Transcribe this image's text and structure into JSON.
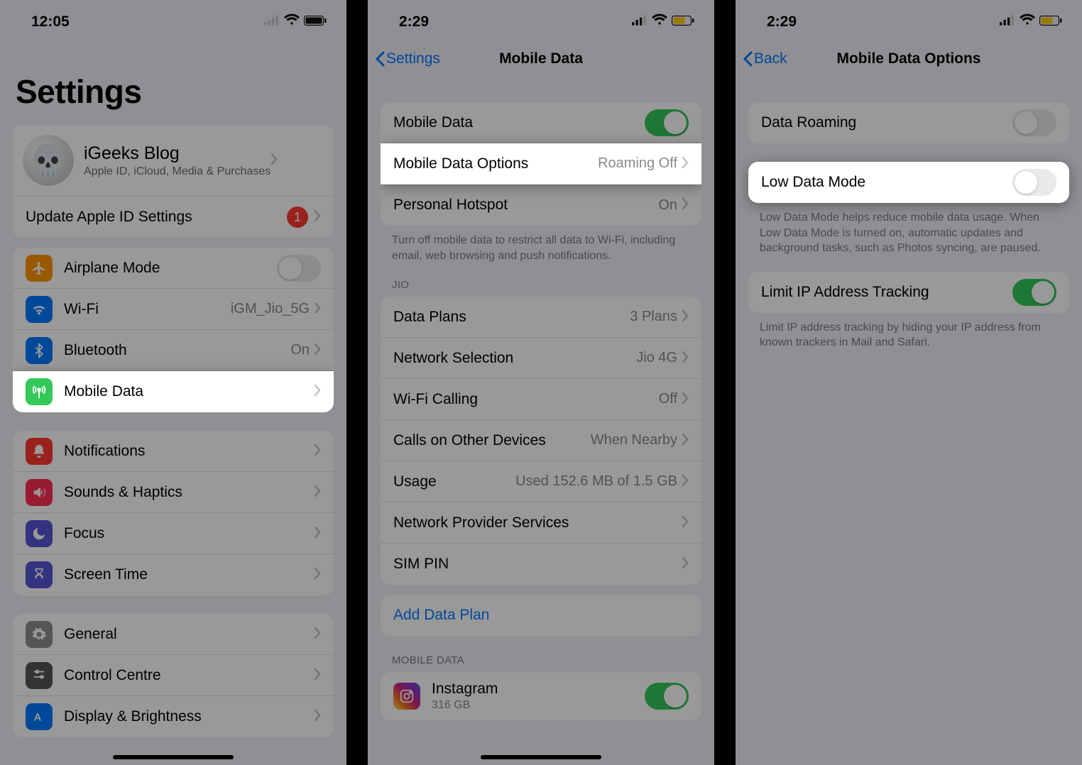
{
  "screen1": {
    "time": "12:05",
    "title": "Settings",
    "profile": {
      "name": "iGeeks Blog",
      "sub": "Apple ID, iCloud, Media & Purchases"
    },
    "update_apple_id": {
      "label": "Update Apple ID Settings",
      "badge": "1"
    },
    "rows": {
      "airplane": "Airplane Mode",
      "wifi": {
        "label": "Wi-Fi",
        "value": "iGM_Jio_5G"
      },
      "bluetooth": {
        "label": "Bluetooth",
        "value": "On"
      },
      "mobile_data": "Mobile Data",
      "notifications": "Notifications",
      "sounds": "Sounds & Haptics",
      "focus": "Focus",
      "screen_time": "Screen Time",
      "general": "General",
      "control_centre": "Control Centre",
      "display": "Display & Brightness"
    }
  },
  "screen2": {
    "time": "2:29",
    "back": "Settings",
    "title": "Mobile Data",
    "rows": {
      "mobile_data": "Mobile Data",
      "options": {
        "label": "Mobile Data Options",
        "value": "Roaming Off"
      },
      "hotspot": {
        "label": "Personal Hotspot",
        "value": "On"
      }
    },
    "note1": "Turn off mobile data to restrict all data to Wi-Fi, including email, web browsing and push notifications.",
    "header_jio": "JIO",
    "jio": {
      "data_plans": {
        "label": "Data Plans",
        "value": "3 Plans"
      },
      "network_selection": {
        "label": "Network Selection",
        "value": "Jio 4G"
      },
      "wifi_calling": {
        "label": "Wi-Fi Calling",
        "value": "Off"
      },
      "calls_other": {
        "label": "Calls on Other Devices",
        "value": "When Nearby"
      },
      "usage": {
        "label": "Usage",
        "value": "Used 152.6 MB of 1.5 GB"
      },
      "provider": "Network Provider Services",
      "sim_pin": "SIM PIN"
    },
    "add_plan": "Add Data Plan",
    "header_md": "MOBILE DATA",
    "app": {
      "name": "Instagram",
      "size": "316 GB"
    }
  },
  "screen3": {
    "time": "2:29",
    "back": "Back",
    "title": "Mobile Data Options",
    "rows": {
      "roaming": "Data Roaming",
      "low_data": "Low Data Mode",
      "limit_ip": "Limit IP Address Tracking"
    },
    "note_low": "Low Data Mode helps reduce mobile data usage. When Low Data Mode is turned on, automatic updates and background tasks, such as Photos syncing, are paused.",
    "note_ip": "Limit IP address tracking by hiding your IP address from known trackers in Mail and Safari."
  }
}
